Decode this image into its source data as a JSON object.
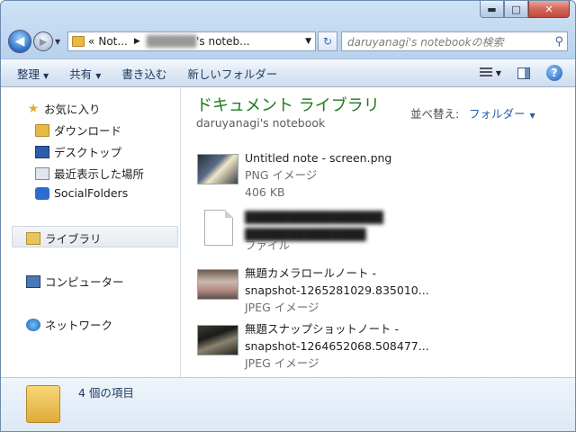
{
  "window": {
    "caption": {
      "minimize": "▬",
      "maximize": "□",
      "close": "✕"
    }
  },
  "nav": {
    "back_glyph": "◀",
    "forward_glyph": "▶",
    "history_glyph": "▼",
    "breadcrumb": [
      "Not...",
      "██████'s noteb..."
    ],
    "breadcrumb_prefix": "«",
    "breadcrumb_second_blurred": "██████",
    "breadcrumb_second_visible": "'s noteb...",
    "address_dropdown": "▼",
    "refresh_glyph": "↻",
    "search_placeholder": "daruyanagi's notebookの検索",
    "search_glyph": "⚲"
  },
  "toolbar": {
    "organize": "整理",
    "share": "共有",
    "burn": "書き込む",
    "new_folder": "新しいフォルダー",
    "dropdown_glyph": "▼",
    "help_glyph": "?"
  },
  "sidebar": {
    "favorites": {
      "label": "お気に入り",
      "items": [
        {
          "label": "ダウンロード"
        },
        {
          "label": "デスクトップ"
        },
        {
          "label": "最近表示した場所"
        },
        {
          "label": "SocialFolders"
        }
      ]
    },
    "libraries": {
      "label": "ライブラリ"
    },
    "computer": {
      "label": "コンピューター"
    },
    "network": {
      "label": "ネットワーク"
    }
  },
  "main": {
    "library_title": "ドキュメント ライブラリ",
    "library_subtitle": "daruyanagi's notebook",
    "sort_label": "並べ替え:",
    "sort_value": "フォルダー",
    "items": [
      {
        "name": "Untitled note - screen.png",
        "type": "PNG イメージ",
        "size": "406 KB"
      },
      {
        "name_blurred_line1": "████████████████",
        "name_blurred_line2": "██████████████",
        "type": "ファイル"
      },
      {
        "name": "無題カメラロールノート -",
        "name_line2": "snapshot-1265281029.835010...",
        "type": "JPEG イメージ"
      },
      {
        "name": "無題スナップショットノート -",
        "name_line2": "snapshot-1264652068.508477...",
        "type": "JPEG イメージ"
      }
    ]
  },
  "details": {
    "count_text": "4 個の項目"
  }
}
